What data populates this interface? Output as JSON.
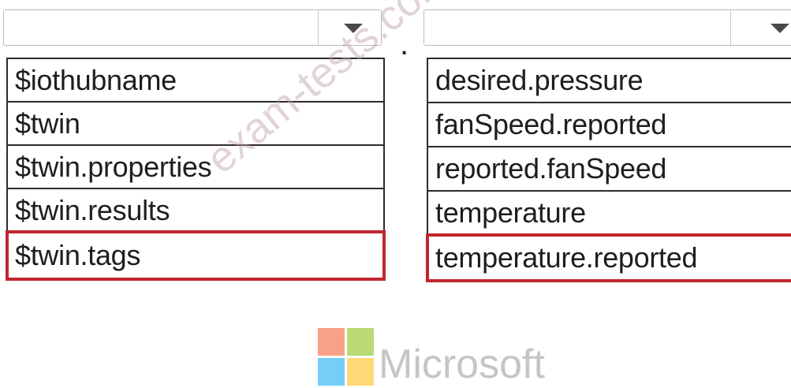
{
  "separator": ".",
  "left_dropdown": {
    "value": "",
    "options": [
      "$iothubname",
      "$twin",
      "$twin.properties",
      "$twin.results",
      "$twin.tags"
    ],
    "selected_index": 4
  },
  "right_dropdown": {
    "value": "",
    "options": [
      "desired.pressure",
      "fanSpeed.reported",
      "reported.fanSpeed",
      "temperature",
      "temperature.reported"
    ],
    "selected_index": 4
  },
  "watermark": {
    "text": "exam-tests.com",
    "brand_text": "Microsoft"
  },
  "colors": {
    "selection_border": "#c0262f",
    "list_border": "#2c2c2c",
    "logo_red": "#f35325",
    "logo_green": "#81bc06",
    "logo_blue": "#05a6f0",
    "logo_yellow": "#ffba08"
  },
  "icons": {
    "dropdown_arrow": "chevron-down-icon"
  }
}
